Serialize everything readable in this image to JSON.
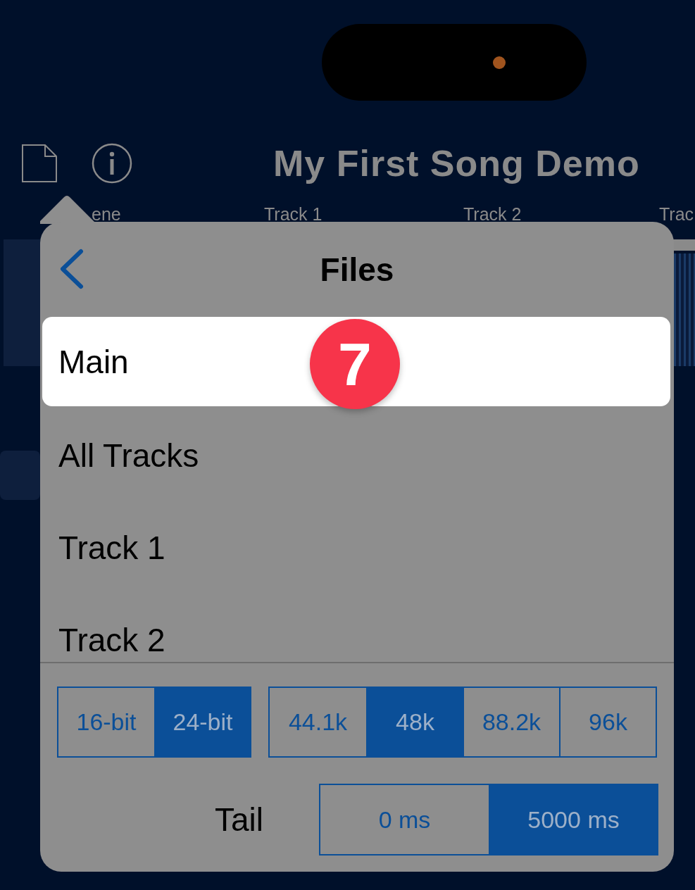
{
  "header": {
    "title": "My First Song Demo"
  },
  "tracks_bar": [
    {
      "label": "ene"
    },
    {
      "label": "Track 1"
    },
    {
      "label": "Track 2"
    },
    {
      "label": "Trac"
    }
  ],
  "popover": {
    "title": "Files",
    "badge": "7",
    "items": [
      {
        "label": "Main",
        "selected": true
      },
      {
        "label": "All Tracks",
        "selected": false
      },
      {
        "label": "Track 1",
        "selected": false
      },
      {
        "label": "Track 2",
        "selected": false
      }
    ],
    "bit_depth": [
      {
        "label": "16-bit",
        "selected": false
      },
      {
        "label": "24-bit",
        "selected": true
      }
    ],
    "sample_rate": [
      {
        "label": "44.1k",
        "selected": false
      },
      {
        "label": "48k",
        "selected": true
      },
      {
        "label": "88.2k",
        "selected": false
      },
      {
        "label": "96k",
        "selected": false
      }
    ],
    "tail": {
      "label": "Tail",
      "options": [
        {
          "label": "0 ms",
          "selected": false
        },
        {
          "label": "5000 ms",
          "selected": true
        }
      ]
    }
  }
}
